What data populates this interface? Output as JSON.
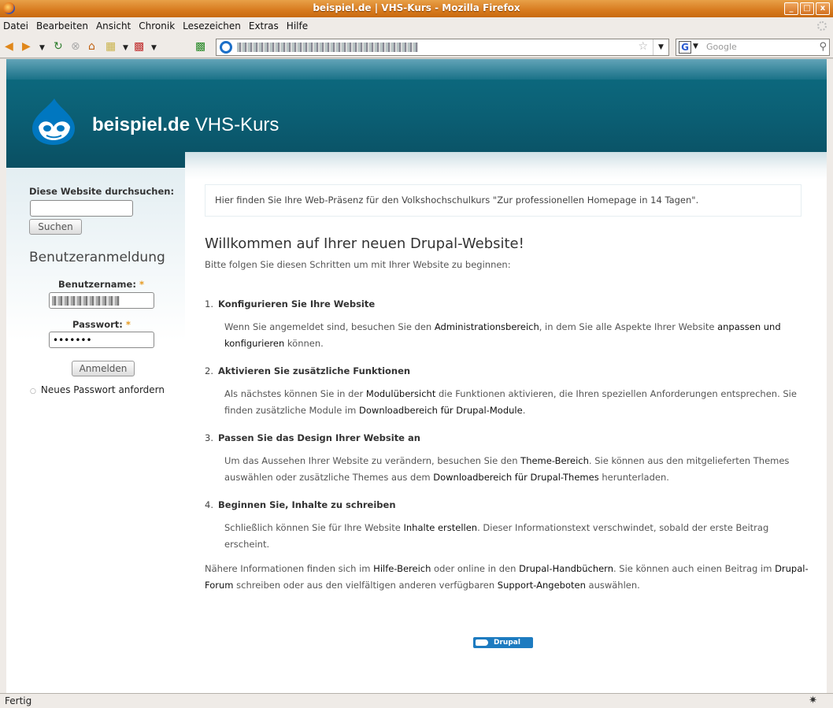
{
  "window": {
    "title": "beispiel.de | VHS-Kurs - Mozilla Firefox",
    "controls": [
      "_",
      "□",
      "x"
    ]
  },
  "menu": [
    "Datei",
    "Bearbeiten",
    "Ansicht",
    "Chronik",
    "Lesezeichen",
    "Extras",
    "Hilfe"
  ],
  "toolbar": {
    "back_icon": "back-arrow-icon",
    "forward_icon": "forward-arrow-icon",
    "search_placeholder": "Google"
  },
  "site": {
    "name_bold": "beispiel.de",
    "name_rest": " VHS-Kurs"
  },
  "sidebar": {
    "search_label": "Diese Website durchsuchen:",
    "search_button": "Suchen",
    "login_title": "Benutzeranmeldung",
    "username_label": "Benutzername:",
    "password_label": "Passwort:",
    "password_value": "•••••••",
    "required_mark": "*",
    "login_button": "Anmelden",
    "new_password_link": "Neues Passwort anfordern"
  },
  "main": {
    "intro": "Hier finden Sie Ihre Web-Präsenz für den Volkshochschulkurs \"Zur professionellen Homepage in 14 Tagen\".",
    "title": "Willkommen auf Ihrer neuen Drupal-Website!",
    "subtitle": "Bitte folgen Sie diesen Schritten um mit Ihrer Website zu beginnen:",
    "steps": [
      {
        "num": "1.",
        "heading": "Konfigurieren Sie Ihre Website",
        "t1": "Wenn Sie angemeldet sind, besuchen Sie den ",
        "l1": "Administrationsbereich",
        "t2": ", in dem Sie alle Aspekte Ihrer Website ",
        "l2": "anpassen und konfigurieren",
        "t3": " können."
      },
      {
        "num": "2.",
        "heading": "Aktivieren Sie zusätzliche Funktionen",
        "t1": "Als nächstes können Sie in der ",
        "l1": "Modulübersicht",
        "t2": " die Funktionen aktivieren, die Ihren speziellen Anforderungen entsprechen. Sie finden zusätzliche Module im ",
        "l2": "Downloadbereich für Drupal-Module",
        "t3": "."
      },
      {
        "num": "3.",
        "heading": "Passen Sie das Design Ihrer Website an",
        "t1": "Um das Aussehen Ihrer Website zu verändern, besuchen Sie den ",
        "l1": "Theme-Bereich",
        "t2": ". Sie können aus den mitgelieferten Themes auswählen oder zusätzliche Themes aus dem ",
        "l2": "Downloadbereich für Drupal-Themes",
        "t3": " herunterladen."
      },
      {
        "num": "4.",
        "heading": "Beginnen Sie, Inhalte zu schreiben",
        "t1": "Schließlich können Sie für Ihre Website ",
        "l1": "Inhalte erstellen",
        "t2": ". Dieser Informationstext verschwindet, sobald der erste Beitrag erscheint.",
        "l2": "",
        "t3": ""
      }
    ],
    "footer": {
      "t1": "Nähere Informationen finden sich im ",
      "l1": "Hilfe-Bereich",
      "t2": " oder online in den ",
      "l2": "Drupal-Handbüchern",
      "t3": ". Sie können auch einen Beitrag im ",
      "l3": "Drupal-Forum",
      "t4": " schreiben oder aus den vielfältigen anderen verfügbaren ",
      "l4": "Support-Angeboten",
      "t5": " auswählen."
    },
    "powered_by": "Drupal"
  },
  "status": {
    "text": "Fertig"
  }
}
